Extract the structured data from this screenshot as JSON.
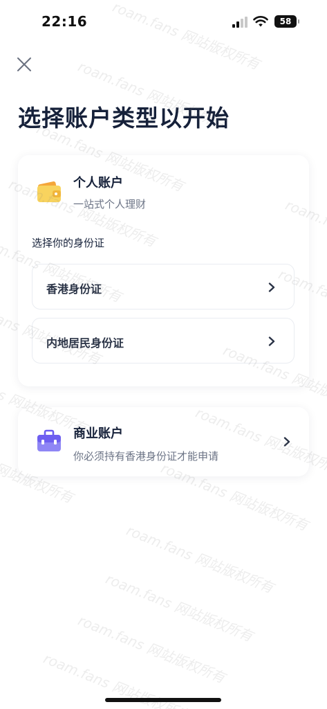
{
  "status_bar": {
    "time": "22:16",
    "battery": "58"
  },
  "page": {
    "title": "选择账户类型以开始"
  },
  "personal_account": {
    "title": "个人账户",
    "subtitle": "一站式个人理财",
    "id_section_label": "选择你的身份证",
    "id_options": [
      {
        "label": "香港身份证"
      },
      {
        "label": "内地居民身份证"
      }
    ]
  },
  "business_account": {
    "title": "商业账户",
    "subtitle": "你必须持有香港身份证才能申请"
  },
  "watermark": {
    "text": "roam.fans 网站版权所有"
  },
  "icons": {
    "close": "close-icon",
    "wallet": "wallet-icon",
    "briefcase": "briefcase-icon",
    "chevron": "chevron-right-icon"
  },
  "colors": {
    "title_text": "#16213a",
    "subtitle_text": "#6b7385",
    "wallet_yellow": "#f6c94b",
    "briefcase_purple": "#7c6cf0"
  }
}
